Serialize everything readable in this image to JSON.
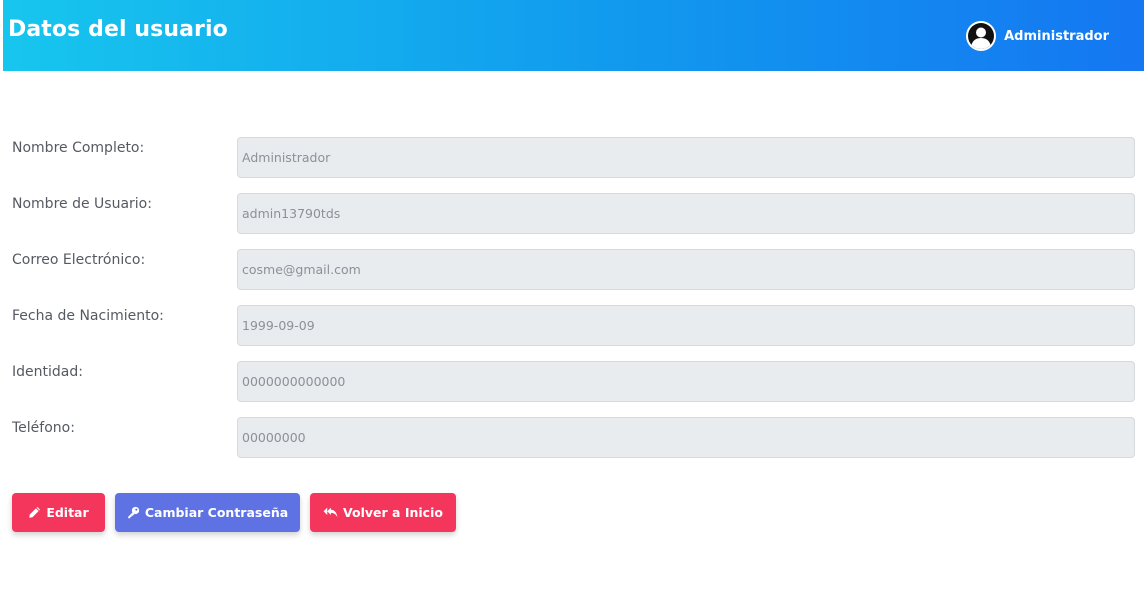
{
  "header": {
    "title": "Datos del usuario",
    "user_name": "Administrador",
    "avatar_icon": "user-avatar-icon",
    "gradient_colors": [
      "#17c6ee",
      "#1577f2"
    ]
  },
  "form": {
    "fields": [
      {
        "label": "Nombre Completo:",
        "value": "Administrador"
      },
      {
        "label": "Nombre de Usuario:",
        "value": "admin13790tds"
      },
      {
        "label": "Correo Electrónico:",
        "value": "cosme@gmail.com"
      },
      {
        "label": "Fecha de Nacimiento:",
        "value": "1999-09-09"
      },
      {
        "label": "Identidad:",
        "value": "0000000000000"
      },
      {
        "label": "Teléfono:",
        "value": "00000000"
      }
    ]
  },
  "actions": {
    "edit_label": "Editar",
    "edit_icon": "pencil-icon",
    "change_password_label": "Cambiar Contraseña",
    "change_password_icon": "key-icon",
    "home_label": "Volver a Inicio",
    "home_icon": "reply-all-icon",
    "colors": {
      "danger": "#f5365c",
      "primary": "#5e72e4"
    }
  }
}
